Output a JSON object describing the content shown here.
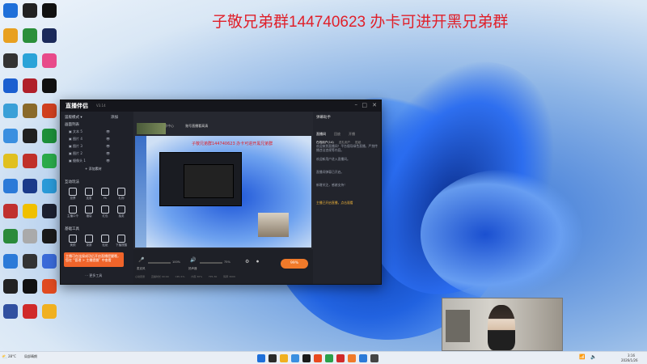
{
  "headline": "子敬兄弟群144740623 办卡可进开黑兄弟群",
  "desktop_icons": [
    {
      "label": "",
      "color": "#1e6fd9"
    },
    {
      "label": "",
      "color": "#222222"
    },
    {
      "label": "",
      "color": "#111111"
    },
    {
      "label": "",
      "color": "#e8a020"
    },
    {
      "label": "",
      "color": "#2a8f3a"
    },
    {
      "label": "",
      "color": "#1b2a5a"
    },
    {
      "label": "",
      "color": "#333333"
    },
    {
      "label": "",
      "color": "#2aa3d8"
    },
    {
      "label": "",
      "color": "#e84a8a"
    },
    {
      "label": "",
      "color": "#1b5fd0"
    },
    {
      "label": "",
      "color": "#b0202a"
    },
    {
      "label": "",
      "color": "#101010"
    },
    {
      "label": "",
      "color": "#3aa0d8"
    },
    {
      "label": "",
      "color": "#8a6a2a"
    },
    {
      "label": "",
      "color": "#d04020"
    },
    {
      "label": "",
      "color": "#3a8fe0"
    },
    {
      "label": "",
      "color": "#202020"
    },
    {
      "label": "",
      "color": "#1d8f3a"
    },
    {
      "label": "",
      "color": "#e0c020"
    },
    {
      "label": "",
      "color": "#c0302a"
    },
    {
      "label": "",
      "color": "#2aaa4a"
    },
    {
      "label": "",
      "color": "#2b7ad8"
    },
    {
      "label": "",
      "color": "#1a3a8a"
    },
    {
      "label": "",
      "color": "#2a9ad8"
    },
    {
      "label": "",
      "color": "#c03030"
    },
    {
      "label": "",
      "color": "#f0c000"
    },
    {
      "label": "",
      "color": "#1b2030"
    },
    {
      "label": "",
      "color": "#2a8a3a"
    },
    {
      "label": "",
      "color": "#aaaaaa"
    },
    {
      "label": "",
      "color": "#1a1a1a"
    },
    {
      "label": "",
      "color": "#2b7ad8"
    },
    {
      "label": "",
      "color": "#333333"
    },
    {
      "label": "",
      "color": "#3a6ad8"
    },
    {
      "label": "",
      "color": "#222222"
    },
    {
      "label": "",
      "color": "#111111"
    },
    {
      "label": "",
      "color": "#e04a20"
    },
    {
      "label": "",
      "color": "#3050a0"
    },
    {
      "label": "",
      "color": "#d02a2a"
    },
    {
      "label": "",
      "color": "#f0b020"
    }
  ],
  "app": {
    "logo": "直播伴侣",
    "version": "V3.14",
    "left": {
      "mode_label": "竖版模式 ▾",
      "scene_label": "场景",
      "add_label": "添加",
      "sources_header": "画面列表",
      "sources": [
        "文本 5",
        "图片 4",
        "图片 3",
        "图片 2",
        "摄像头 1"
      ],
      "add_source": "+ 添加素材",
      "interact_header": "互动玩法",
      "interact_tools": [
        "投票",
        "连麦",
        "PK",
        "礼物",
        "主播口令",
        "福袋",
        "红包",
        "抽奖"
      ],
      "basic_header": "基础工具",
      "basic_tools": [
        "美颜",
        "录屏",
        "贴纸",
        "下播提醒"
      ],
      "tip": "主播可在连接成功后开启直播提醒哦，您在 “管理 > 主播提醒” 中查看",
      "more": "⋯ 更多工具"
    },
    "center": {
      "tabs": [
        "画面素材",
        "创作中心"
      ],
      "account_line": "账号直播看高清",
      "preview_overlay": "子敬兄弟群144740623 办卡可进开黑兄弟群",
      "mic_label": "麦克风",
      "mic_value": "100%",
      "speaker_label": "扬声器",
      "speaker_value": "75%",
      "live_label": "开始直播",
      "live_value": "99%",
      "status_items": [
        "心动观测",
        "直播时长 00:00",
        "CPU 4%",
        "内存 30%",
        "FPS 30",
        "码率 3000"
      ]
    },
    "right": {
      "header": "弹幕助手",
      "tabs": [
        "直播间",
        "回放",
        "开播"
      ],
      "sub_tabs": [
        "在线用户(14)",
        "送礼用户",
        "贴纸"
      ],
      "messages": [
        "欢迎来到直播间！平台倡导绿色直播，严禁传播违法违规等内容。",
        "欢迎新用户进入直播间。",
        "直播间弹幕已开启。",
        "新增关注，感谢支持！"
      ],
      "highlight": "主播已开启直播，点击观看"
    }
  },
  "taskbar": {
    "weather_line1": "28°C",
    "weather_line2": "局部晴朗",
    "clock_time": "3:16",
    "clock_date": "2026/1/26"
  }
}
